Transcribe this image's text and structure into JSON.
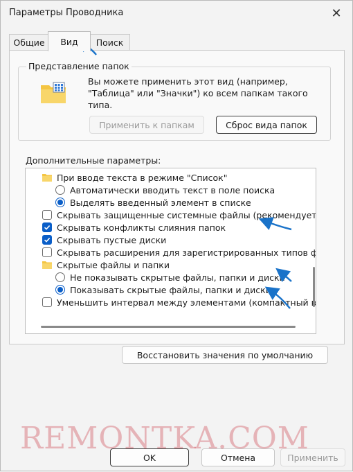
{
  "window": {
    "title": "Параметры Проводника"
  },
  "tabs": [
    {
      "label": "Общие"
    },
    {
      "label": "Вид"
    },
    {
      "label": "Поиск"
    }
  ],
  "folder_views": {
    "legend": "Представление папок",
    "description": "Вы можете применить этот вид (например, \"Таблица\" или \"Значки\") ко всем папкам такого типа.",
    "apply_button": "Применить к папкам",
    "reset_button": "Сброс вида папок"
  },
  "advanced": {
    "label": "Дополнительные параметры:",
    "items": [
      {
        "type": "folder",
        "label": "При вводе текста в режиме \"Список\""
      },
      {
        "type": "radio",
        "checked": false,
        "label": "Автоматически вводить текст в поле поиска"
      },
      {
        "type": "radio",
        "checked": true,
        "label": "Выделять введенный элемент в списке"
      },
      {
        "type": "checkbox",
        "checked": false,
        "label": "Скрывать защищенные системные файлы (рекомендуется)"
      },
      {
        "type": "checkbox",
        "checked": true,
        "label": "Скрывать конфликты слияния папок"
      },
      {
        "type": "checkbox",
        "checked": true,
        "label": "Скрывать пустые диски"
      },
      {
        "type": "checkbox",
        "checked": false,
        "label": "Скрывать расширения для зарегистрированных типов файлов"
      },
      {
        "type": "folder",
        "label": "Скрытые файлы и папки"
      },
      {
        "type": "radio",
        "checked": false,
        "label": "Не показывать скрытые файлы, папки и диски"
      },
      {
        "type": "radio",
        "checked": true,
        "label": "Показывать скрытые файлы, папки и диски"
      },
      {
        "type": "checkbox",
        "checked": false,
        "label": "Уменьшить интервал между элементами (компактный вид)"
      }
    ]
  },
  "restore_button": "Восстановить значения по умолчанию",
  "footer": {
    "ok": "OK",
    "cancel": "Отмена",
    "apply": "Применить"
  },
  "watermark": "REMONTKA.COM",
  "colors": {
    "accent": "#0a5ec8",
    "arrow": "#1a73c9",
    "watermark": "#c8323c"
  }
}
